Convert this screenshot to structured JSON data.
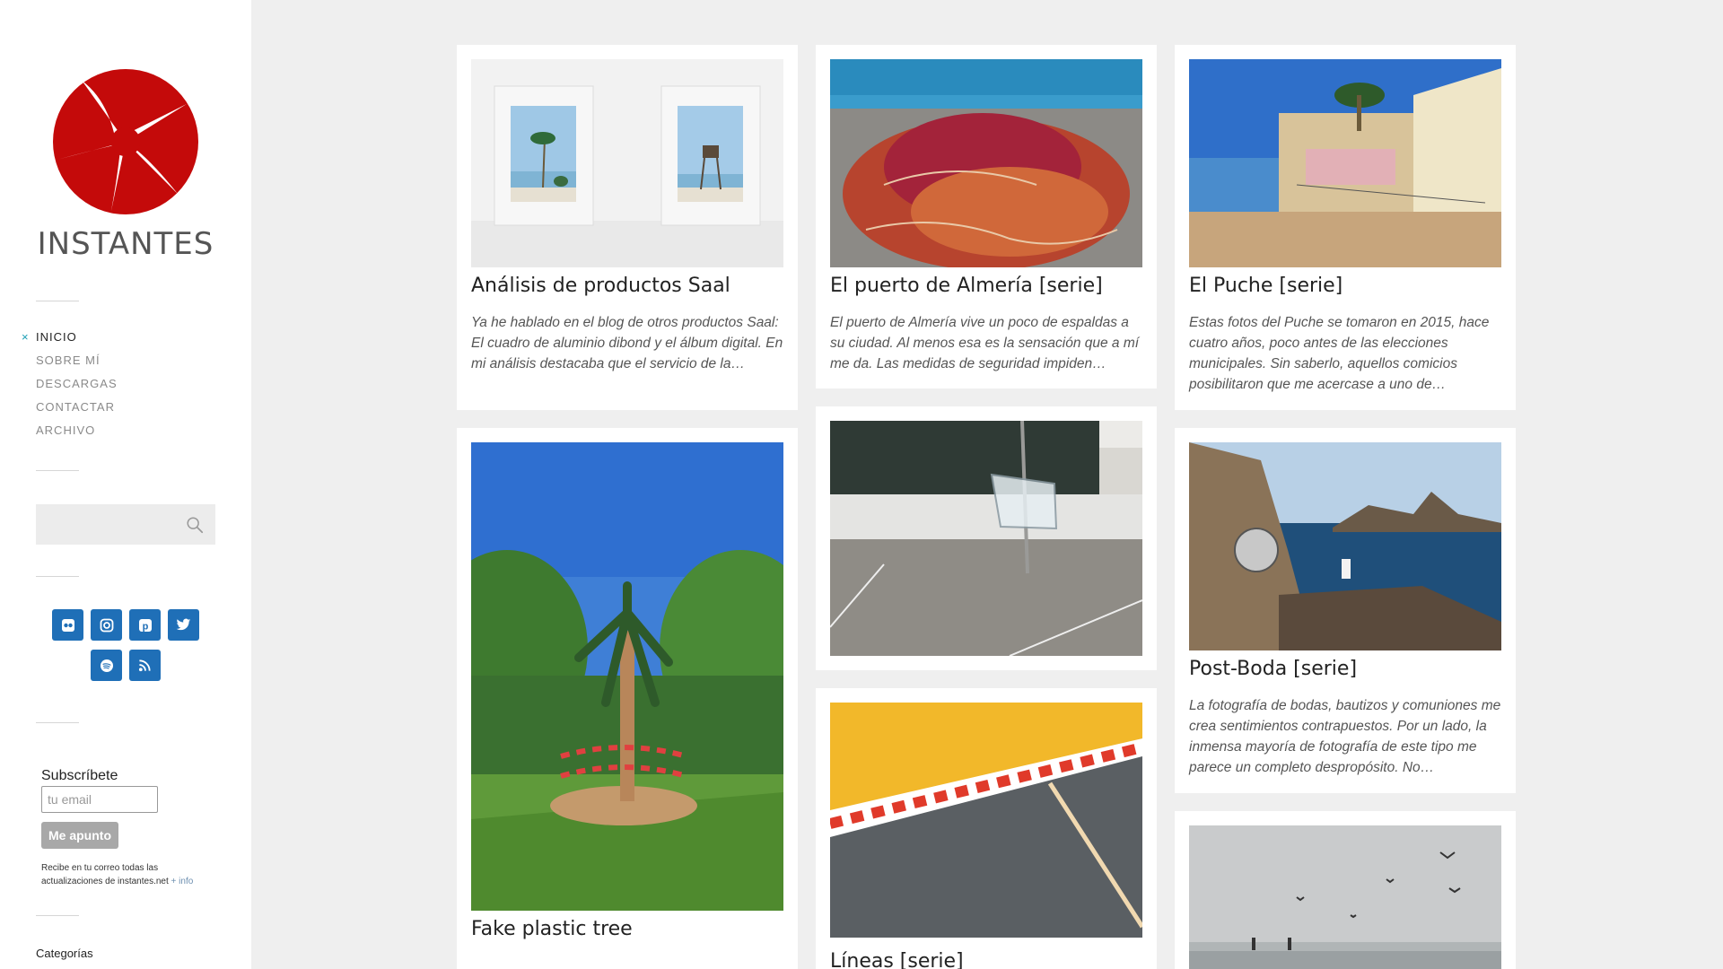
{
  "site": {
    "title": "INSTANTES",
    "accent_color": "#c40a0a"
  },
  "nav": {
    "items": [
      {
        "label": "INICIO",
        "active": true
      },
      {
        "label": "SOBRE MÍ"
      },
      {
        "label": "DESCARGAS"
      },
      {
        "label": "CONTACTAR"
      },
      {
        "label": "ARCHIVO"
      }
    ],
    "active_marker": "×"
  },
  "search": {
    "placeholder": "",
    "icon": "search-icon"
  },
  "social": {
    "icons": [
      "flickr-icon",
      "instagram-icon",
      "pinterest-icon",
      "twitter-icon",
      "spotify-icon",
      "rss-icon"
    ],
    "color": "#1f6fb7"
  },
  "subscribe": {
    "label": "Subscríbete",
    "placeholder": "tu email",
    "button": "Me apunto",
    "note": "Recibe en tu correo todas las actualizaciones de instantes.net",
    "more_link": "+ info"
  },
  "categories": {
    "label": "Categorías"
  },
  "posts": {
    "col1": [
      {
        "title": "Análisis de productos Saal",
        "excerpt": "Ya he hablado en el blog de otros productos Saal: El cuadro de aluminio dibond y el álbum digital. En mi análisis destacaba que el servicio de la…"
      },
      {
        "title": "Fake plastic tree",
        "excerpt": ""
      }
    ],
    "col2": [
      {
        "title": "El puerto de Almería [serie]",
        "excerpt": "El puerto de Almería vive un poco de espaldas a su ciudad. Al menos esa es la sensación que a mí me da. Las medidas de seguridad impiden…"
      },
      {
        "title": "",
        "excerpt": ""
      },
      {
        "title": "Líneas [serie]",
        "excerpt": ""
      }
    ],
    "col3": [
      {
        "title": "El Puche [serie]",
        "excerpt": "Estas fotos del Puche se tomaron en 2015, hace cuatro años, poco antes de las elecciones municipales. Sin saberlo, aquellos comicios posibilitaron que me acercase a uno de…"
      },
      {
        "title": "Post-Boda [serie]",
        "excerpt": "La fotografía de bodas, bautizos y comuniones me crea sentimientos contrapuestos. Por un lado,  la inmensa mayoría de fotografía de este tipo me parece un completo despropósito. No…"
      },
      {
        "title": "",
        "excerpt": ""
      }
    ]
  }
}
